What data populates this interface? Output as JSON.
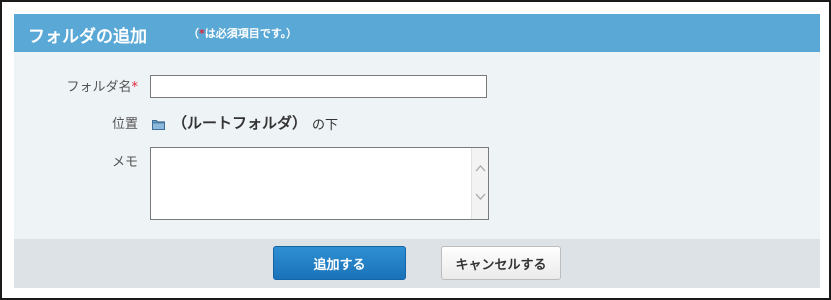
{
  "dialog": {
    "title": "フォルダの追加",
    "note_open": "（",
    "note_star": "*",
    "note_text": "は必須項目です。）"
  },
  "form": {
    "name_label": "フォルダ名",
    "name_required": "*",
    "name_value": "",
    "location_label": "位置",
    "location_folder": "（ルートフォルダ）",
    "location_suffix": "の下",
    "memo_label": "メモ",
    "memo_value": ""
  },
  "buttons": {
    "add_label": "追加する",
    "cancel_label": "キャンセルする"
  },
  "colors": {
    "header": "#5aa8d6",
    "required": "#e0243a",
    "primary_button": "#1a72b8"
  },
  "icons": {
    "location": "folder-icon",
    "scroll_up": "chevron-up-icon",
    "scroll_down": "chevron-down-icon"
  }
}
